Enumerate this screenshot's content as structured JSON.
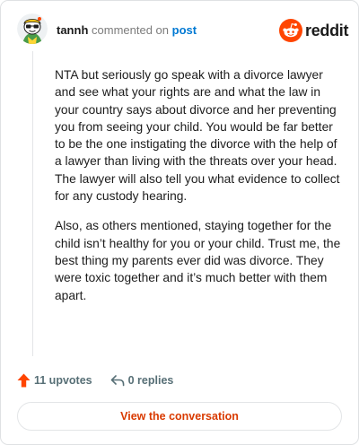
{
  "header": {
    "username": "tannh",
    "action_text": "commented on",
    "post_link": "post",
    "brand_name": "reddit",
    "avatar_icon": "snoo-avatar-icon",
    "brand_icon": "reddit-alien-icon"
  },
  "comment": {
    "paragraphs": [
      "NTA but seriously go speak with a divorce lawyer and see what your rights are and what the law in your country says about divorce and her preventing you from seeing your child. You would be far better to be the one instigating the divorce with the help of a lawyer than living with the threats over your head. The lawyer will also tell you what evidence to collect for any custody hearing.",
      "Also, as others mentioned, staying together for the child isn’t healthy for you or your child. Trust me, the best thing my parents ever did was divorce. They were toxic together and it’s much better with them apart."
    ]
  },
  "actions": {
    "upvotes_label": "11 upvotes",
    "replies_label": "0 replies",
    "upvote_icon": "upvote-arrow-icon",
    "reply_icon": "reply-arrow-icon"
  },
  "cta": {
    "label": "View the conversation"
  },
  "colors": {
    "brand": "#ff4500",
    "link": "#0079d3",
    "cta_text": "#d93a00",
    "muted": "#7c7c7c"
  }
}
